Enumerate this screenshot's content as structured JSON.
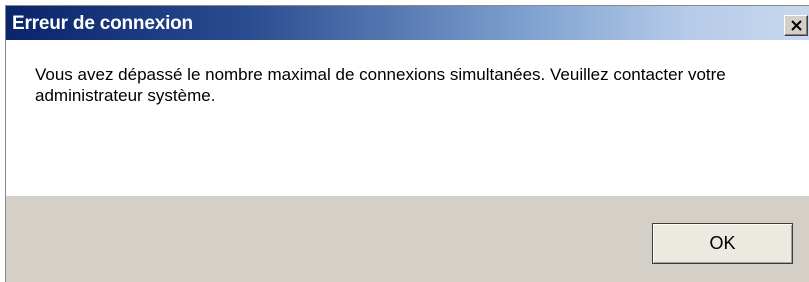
{
  "dialog": {
    "title": "Erreur de connexion",
    "close_icon": "close-icon",
    "message": "Vous avez dépassé le nombre maximal de connexions simultanées. Veuillez contacter votre administrateur système.",
    "ok_label": "OK"
  },
  "colors": {
    "titlebar_start": "#0a246a",
    "titlebar_end": "#c8d8ef",
    "content_background": "#ffffff",
    "footer_background": "#d4d0c8"
  }
}
